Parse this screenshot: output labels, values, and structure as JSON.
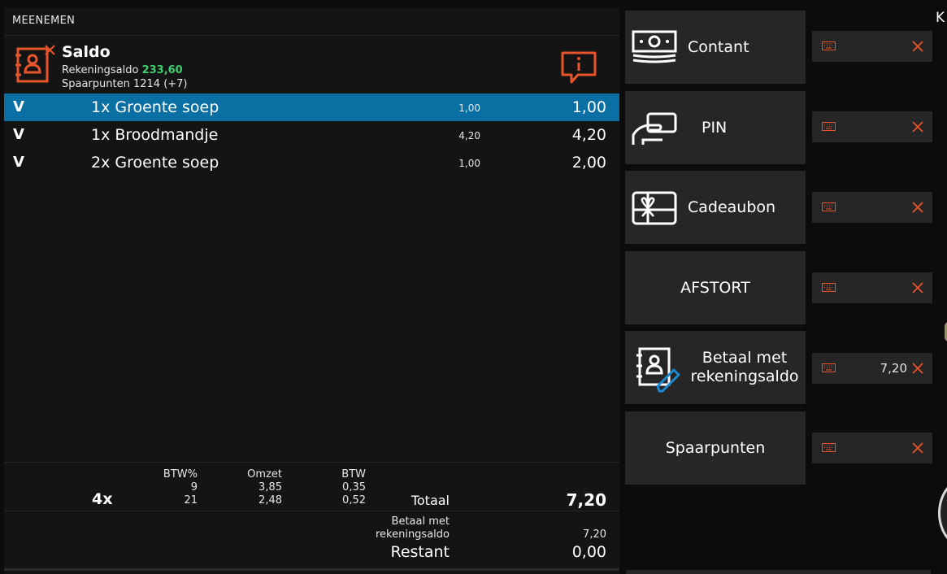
{
  "order": {
    "mode_label": "MEENEMEN",
    "customer": {
      "title": "Saldo",
      "balance_label": "Rekeningsaldo",
      "balance_value": "233,60",
      "points_text": "Spaarpunten 1214 (+7)"
    },
    "lines": [
      {
        "flag": "V",
        "description": "1x Groente soep",
        "unit_price": "1,00",
        "total": "1,00",
        "selected": true
      },
      {
        "flag": "V",
        "description": "1x Broodmandje",
        "unit_price": "4,20",
        "total": "4,20",
        "selected": false
      },
      {
        "flag": "V",
        "description": "2x Groente soep",
        "unit_price": "1,00",
        "total": "2,00",
        "selected": false
      }
    ]
  },
  "summary": {
    "item_count": "4x",
    "headers": {
      "btw_pct": "BTW%",
      "omzet": "Omzet",
      "btw": "BTW"
    },
    "rows": [
      {
        "btw_pct": "9",
        "omzet": "3,85",
        "btw": "0,35"
      },
      {
        "btw_pct": "21",
        "omzet": "2,48",
        "btw": "0,52"
      }
    ],
    "total_label": "Totaal",
    "total_value": "7,20",
    "payment_label_1": "Betaal met",
    "payment_label_2": "rekeningsaldo",
    "payment_value": "7,20",
    "remaining_label": "Restant",
    "remaining_value": "0,00"
  },
  "payment_methods": [
    {
      "label": "Contant",
      "icon": "cash-icon",
      "amount": ""
    },
    {
      "label": "PIN",
      "icon": "card-payment-icon",
      "amount": ""
    },
    {
      "label": "Cadeaubon",
      "icon": "gift-card-icon",
      "amount": ""
    },
    {
      "label": "AFSTORT",
      "icon": "",
      "amount": ""
    },
    {
      "label_line1": "Betaal met",
      "label_line2": "rekeningsaldo",
      "icon": "account-balance-icon",
      "amount": "7,20"
    },
    {
      "label": "Spaarpunten",
      "icon": "",
      "amount": ""
    }
  ],
  "edge": {
    "letter": "K"
  },
  "colors": {
    "accent_orange": "#e8552a",
    "selected_blue": "#0a6fa3",
    "positive_green": "#3dcf6e",
    "panel_bg": "#141414",
    "button_bg": "#262626"
  }
}
